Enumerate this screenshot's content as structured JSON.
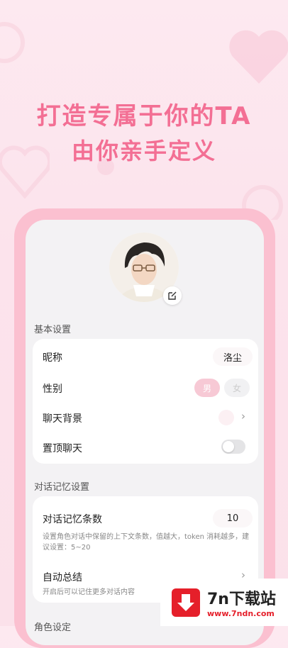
{
  "headline": {
    "line1": "打造专属于你的TA",
    "line2": "由你亲手定义"
  },
  "basic": {
    "title": "基本设置",
    "nickname_label": "昵称",
    "nickname_value": "洛尘",
    "gender_label": "性别",
    "gender_male": "男",
    "gender_female": "女",
    "gender_selected": "男",
    "chat_bg_label": "聊天背景",
    "pin_label": "置顶聊天",
    "pin_on": false
  },
  "memory": {
    "title": "对话记忆设置",
    "count_label": "对话记忆条数",
    "count_value": "10",
    "count_hint": "设置角色对话中保留的上下文条数，值越大，token 消耗越多，建议设置：5~20",
    "auto_label": "自动总结",
    "auto_hint": "开启后可以记住更多对话内容"
  },
  "next_section": {
    "title": "角色设定"
  },
  "watermark": {
    "brand": "7n下载站",
    "url": "www.7ndn.com"
  },
  "colors": {
    "accent": "#f36f94",
    "phone_frame": "#fbc0d0",
    "male_pill": "#f7c9d5"
  }
}
